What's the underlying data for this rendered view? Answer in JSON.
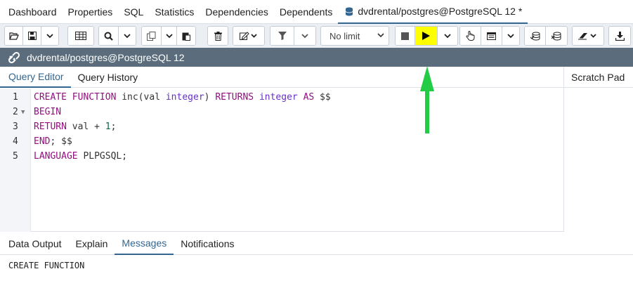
{
  "top_tabs": [
    {
      "label": "Dashboard"
    },
    {
      "label": "Properties"
    },
    {
      "label": "SQL"
    },
    {
      "label": "Statistics"
    },
    {
      "label": "Dependencies"
    },
    {
      "label": "Dependents"
    },
    {
      "label": "dvdrental/postgres@PostgreSQL 12 *",
      "icon": "database-icon",
      "active": true
    }
  ],
  "toolbar": {
    "limit_select": "No limit",
    "buttons": [
      "open-file-icon",
      "save-icon",
      "chevron-down-icon",
      "grid-icon",
      "search-icon",
      "chevron-down-icon",
      "copy-icon",
      "paste-icon",
      "delete-icon",
      "edit-icon",
      "chevron-down-icon",
      "filter-icon",
      "chevron-down-icon",
      "stop-icon",
      "play-icon",
      "chevron-down-icon",
      "pointer-icon",
      "list-icon",
      "chevron-down-icon",
      "commit-icon",
      "rollback-icon",
      "eraser-icon",
      "download-icon"
    ],
    "play_highlight": "#ffff00"
  },
  "connection": {
    "label": "dvdrental/postgres@PostgreSQL 12",
    "icon": "connection-icon",
    "bar_color": "#5b6d7c"
  },
  "editor_tabs": [
    {
      "label": "Query Editor",
      "active": true
    },
    {
      "label": "Query History"
    }
  ],
  "scratch_pad": {
    "label": "Scratch Pad"
  },
  "code": {
    "line_numbers": [
      "1",
      "2",
      "3",
      "4",
      "5"
    ],
    "lines": [
      [
        {
          "t": "CREATE FUNCTION ",
          "c": "kw"
        },
        {
          "t": "inc(val ",
          "c": ""
        },
        {
          "t": "integer",
          "c": "tp"
        },
        {
          "t": ") ",
          "c": ""
        },
        {
          "t": "RETURNS ",
          "c": "kw"
        },
        {
          "t": "integer ",
          "c": "tp"
        },
        {
          "t": "AS ",
          "c": "kw"
        },
        {
          "t": "$$",
          "c": ""
        }
      ],
      [
        {
          "t": "BEGIN",
          "c": "kw"
        }
      ],
      [
        {
          "t": "RETURN ",
          "c": "kw"
        },
        {
          "t": "val + ",
          "c": ""
        },
        {
          "t": "1",
          "c": "num"
        },
        {
          "t": ";",
          "c": ""
        }
      ],
      [
        {
          "t": "END",
          "c": "kw"
        },
        {
          "t": "; $$",
          "c": ""
        }
      ],
      [
        {
          "t": "LANGUAGE ",
          "c": "kw"
        },
        {
          "t": "PLPGSQL;",
          "c": ""
        }
      ]
    ]
  },
  "output_tabs": [
    {
      "label": "Data Output"
    },
    {
      "label": "Explain"
    },
    {
      "label": "Messages",
      "active": true
    },
    {
      "label": "Notifications"
    }
  ],
  "output_message": "CREATE FUNCTION",
  "annotation": {
    "arrow_color": "#22cc44"
  }
}
